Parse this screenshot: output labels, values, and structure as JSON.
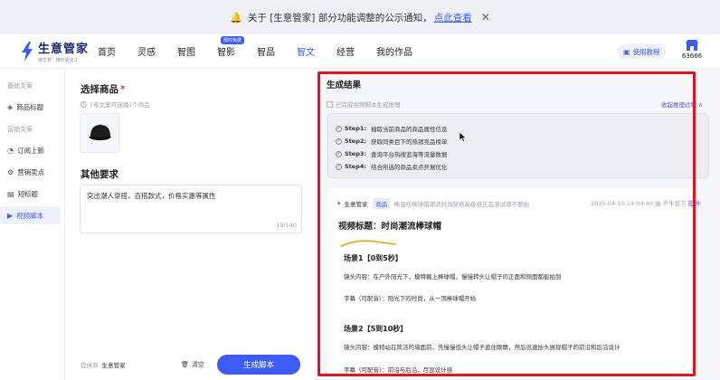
{
  "notice": {
    "text": "关于 [生意管家] 部分功能调整的公示通知，",
    "link": "点此查看",
    "bell_icon": "bell-icon",
    "close_icon": "close-icon"
  },
  "header": {
    "brand": "生意管家",
    "slogan": "做生意 · 懂你更省工",
    "nav": [
      {
        "label": "首页"
      },
      {
        "label": "灵感"
      },
      {
        "label": "智图"
      },
      {
        "label": "智影",
        "badge": "限时免费"
      },
      {
        "label": "智品"
      },
      {
        "label": "智文",
        "active": true
      },
      {
        "label": "经营"
      },
      {
        "label": "我的作品"
      }
    ],
    "tutorial": "使用教程",
    "credit": "63666"
  },
  "sidebar": {
    "group1": "基础文案",
    "group1_items": [
      {
        "icon": "tag-icon",
        "label": "商品标题"
      }
    ],
    "group2": "营销文案",
    "group2_items": [
      {
        "icon": "megaphone-icon",
        "label": "订阅上新"
      },
      {
        "icon": "gear-icon",
        "label": "营销卖点"
      },
      {
        "icon": "document-icon",
        "label": "短标题"
      },
      {
        "icon": "video-icon",
        "label": "视频脚本",
        "active": true
      }
    ]
  },
  "form": {
    "select_title": "选择商品",
    "required_mark": "*",
    "select_hint": "1条文案可选择1个商品",
    "other_title": "其他要求",
    "requirement": "突出潮人穿搭，百搭款式，价格实惠等属性",
    "count": "19/140",
    "provider_label": "提供商",
    "provider": "生意管家",
    "clear": "清空",
    "generate": "生成脚本"
  },
  "result": {
    "title": "生成结果",
    "checkbox": "已完成视频脚本生成推理",
    "collapse": "收起推理过程 ∧",
    "steps": [
      {
        "label": "Step1:",
        "text": "抽取当前商品的商品属性信息"
      },
      {
        "label": "Step2:",
        "text": "获取同类目下的热销竞品榜单"
      },
      {
        "label": "Step3:",
        "text": "查询平台热搜蓝海等流量数据"
      },
      {
        "label": "Step4:",
        "text": "结合所选的商品卖点开展优化"
      }
    ],
    "card": {
      "source": "生意管家",
      "tag": "商品",
      "product_desc": "棒混纺棒球帽潮流时尚穿搭高级感正品测试请不要拍",
      "time": "2025-04-10 14:04:40",
      "author_prefix": "由",
      "author": "千牛官方",
      "author_suffix": "提供",
      "video_title": "视频标题：时尚潮流棒球帽",
      "scenes": [
        {
          "heading": "场景1【0到5秒】",
          "shot": "镜头内容：在户外阳光下，模特戴上棒球帽，慢慢转头让帽子的正面和侧面都能拍到",
          "subtitle": "字幕（可配音）：阳光下的时尚，从一顶棒球帽开始"
        },
        {
          "heading": "场景2【5到10秒】",
          "shot": "镜头内容：模特站在简洁的墙面前，先慢慢低头让帽子遮住眼睛，然后迅速抬头展现帽子的前沿和后沿设计",
          "subtitle": "字幕（可配音）：前沿与后沿，尽显设计感"
        }
      ]
    }
  },
  "colors": {
    "accent": "#3d5bf5",
    "highlight_border": "#e5141b"
  }
}
